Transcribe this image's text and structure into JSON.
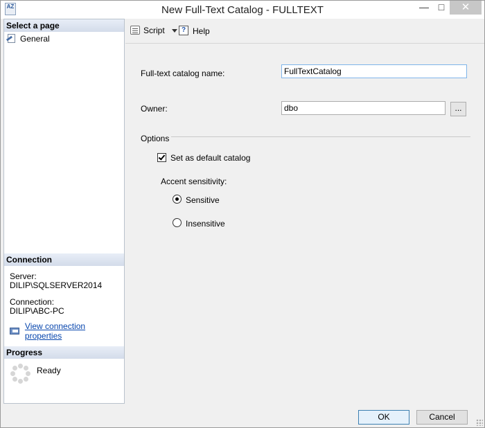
{
  "window": {
    "title": "New Full-Text Catalog - FULLTEXT",
    "app_icon_text": "AZ",
    "minimize_glyph": "—",
    "maximize_glyph": "□",
    "close_glyph": "✕"
  },
  "left_panel": {
    "select_page_header": "Select a page",
    "pages": [
      {
        "label": "General",
        "icon": "general-page-icon"
      }
    ],
    "connection_header": "Connection",
    "server_label": "Server:",
    "server_value": "DILIP\\SQLSERVER2014",
    "connection_label": "Connection:",
    "connection_value": "DILIP\\ABC-PC",
    "view_properties_link": "View connection properties",
    "progress_header": "Progress",
    "progress_status": "Ready"
  },
  "toolbar": {
    "script_label": "Script",
    "help_label": "Help"
  },
  "form": {
    "catalog_name_label": "Full-text catalog name:",
    "catalog_name_value": "FullTextCatalog",
    "owner_label": "Owner:",
    "owner_value": "dbo",
    "browse_label": "...",
    "options_header": "Options",
    "default_catalog_label": "Set as default catalog",
    "default_catalog_checked": true,
    "accent_sensitivity_label": "Accent sensitivity:",
    "sensitive_label": "Sensitive",
    "insensitive_label": "Insensitive",
    "selected_accent": "Sensitive"
  },
  "buttons": {
    "ok_label": "OK",
    "cancel_label": "Cancel"
  },
  "colors": {
    "link": "#0645ad",
    "header_gradient_top": "#e8eef7",
    "header_gradient_bottom": "#d3dcea",
    "focus_border": "#7eb4ea"
  }
}
